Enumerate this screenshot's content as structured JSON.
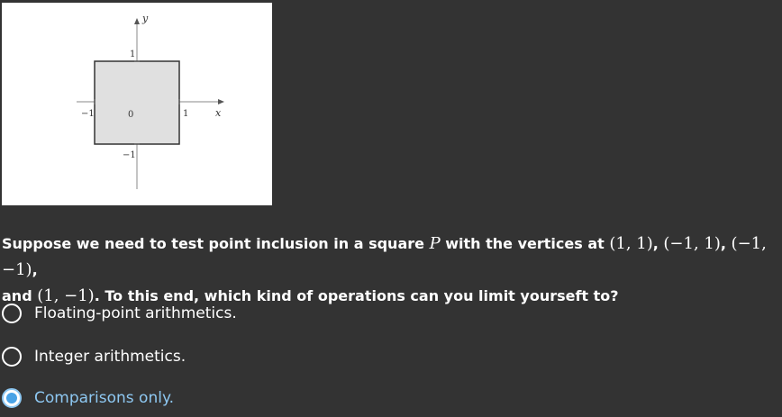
{
  "figure": {
    "axis_x_label": "x",
    "axis_y_label": "y",
    "tick_x_neg": "−1",
    "tick_x_pos": "1",
    "tick_origin": "0",
    "tick_y_pos": "1",
    "tick_y_neg": "−1",
    "square_fill": "#e0e0e0",
    "square_stroke": "#333333"
  },
  "question": {
    "part1": "Suppose we need to test point inclusion in a square ",
    "var_P": "P",
    "part2": " with the vertices at ",
    "v1": "(1, 1)",
    "sep1": ", ",
    "v2": "(−1, 1)",
    "sep2": ", ",
    "v3": "(−1, −1)",
    "sep3": ",",
    "part3": " and ",
    "v4": "(1, −1)",
    "part4": ". To this end, which kind of operations can you limit yourseft to?"
  },
  "options": [
    {
      "label": "Floating-point arithmetics.",
      "selected": false
    },
    {
      "label": "Integer arithmetics.",
      "selected": false
    },
    {
      "label": "Comparisons only.",
      "selected": true
    }
  ],
  "colors": {
    "background": "#333333",
    "selected_accent": "#4aa3e6",
    "selected_text": "#8ec8f2"
  }
}
